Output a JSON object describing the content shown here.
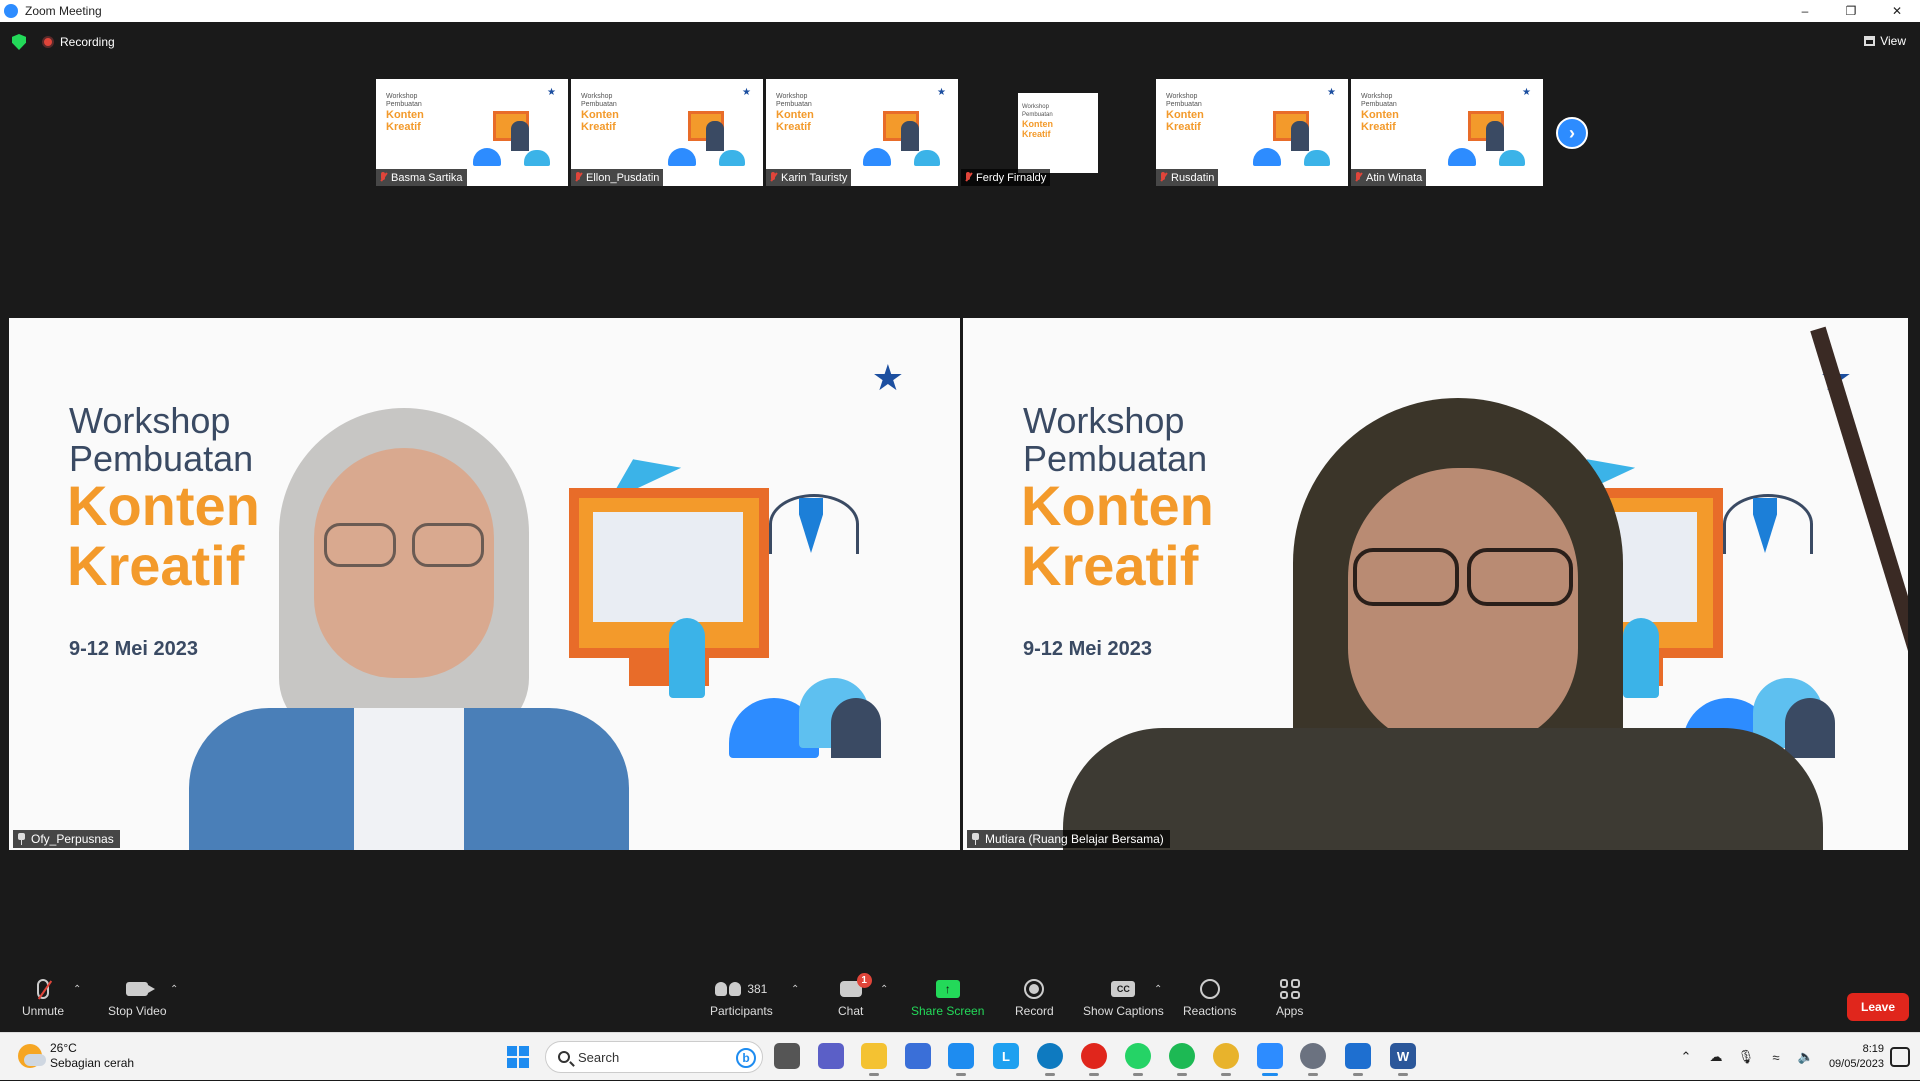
{
  "window": {
    "title": "Zoom Meeting",
    "controls": [
      "minimize-icon",
      "restore-icon",
      "close-icon"
    ]
  },
  "infobar": {
    "recording_label": "Recording",
    "view_label": "View"
  },
  "thumbnails": [
    {
      "name": "Basma Sartika",
      "muted": true
    },
    {
      "name": "Ellon_Pusdatin",
      "muted": true
    },
    {
      "name": "Karin Tauristy",
      "muted": true
    },
    {
      "name": "Ferdy Firnaldy",
      "muted": true
    },
    {
      "name": "Rusdatin",
      "muted": true
    },
    {
      "name": "Atin Winata",
      "muted": true
    }
  ],
  "slide": {
    "line1": "Workshop",
    "line2": "Pembuatan",
    "line3": "Konten",
    "line4": "Kreatif",
    "dates": "9-12 Mei 2023"
  },
  "main_tiles": [
    {
      "name": "Ofy_Perpusnas",
      "active_speaker": true
    },
    {
      "name": "Mutiara (Ruang Belajar Bersama)",
      "active_speaker": false
    }
  ],
  "toolbar": {
    "unmute": "Unmute",
    "stop_video": "Stop Video",
    "participants": "Participants",
    "participant_count": "381",
    "chat": "Chat",
    "chat_badge": "1",
    "share_screen": "Share Screen",
    "record": "Record",
    "show_captions": "Show Captions",
    "cc_glyph": "CC",
    "reactions": "Reactions",
    "apps": "Apps",
    "leave": "Leave"
  },
  "taskbar": {
    "temperature": "26°C",
    "weather": "Sebagian cerah",
    "search_placeholder": "Search",
    "time": "8:19",
    "date": "09/05/2023",
    "pinned_apps": [
      "file-explorer-icon",
      "zoom-icon",
      "edge-icon",
      "opera-icon",
      "whatsapp-icon",
      "spotify-icon",
      "chrome-icon",
      "settings-icon",
      "word-icon"
    ],
    "colors": {
      "accent": "#1e8cf0",
      "zoom_blue": "#2d8cff",
      "leave_red": "#e0261c",
      "share_green": "#23d959"
    }
  }
}
